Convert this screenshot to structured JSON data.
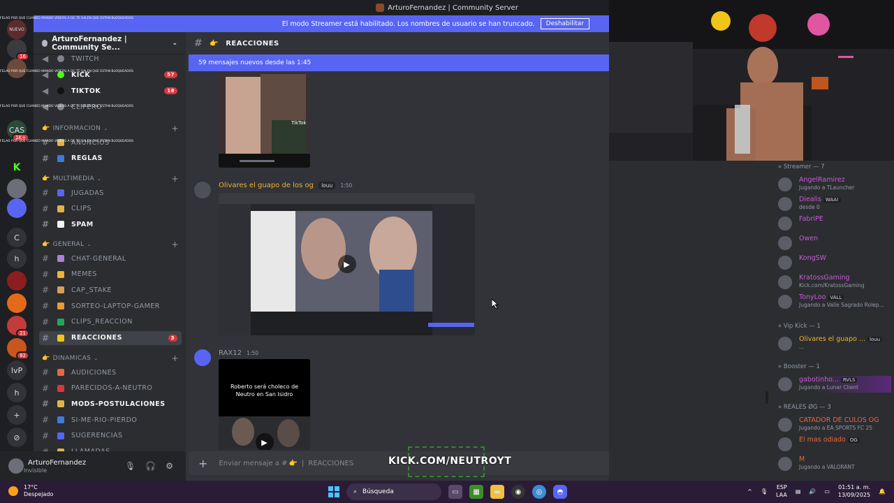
{
  "window": {
    "title": "ArturoFernandez | Community Server"
  },
  "banner": {
    "text": "El modo Streamer está habilitado. Los nombres de usuario se han truncado.",
    "button": "Deshabilitar"
  },
  "server": {
    "name": "ArturoFernandez | Community Se..."
  },
  "rail": [
    {
      "label": "NUEVO",
      "badge": ""
    },
    {
      "label": "",
      "badge": "16"
    },
    {
      "label": "",
      "badge": ""
    },
    {
      "label": "CAS",
      "badge": "1K+"
    },
    {
      "label": "K",
      "badge": ""
    },
    {
      "label": "",
      "badge": ""
    },
    {
      "label": "",
      "badge": ""
    },
    {
      "label": "C",
      "badge": ""
    },
    {
      "label": "h",
      "badge": ""
    },
    {
      "label": "",
      "badge": ""
    },
    {
      "label": "",
      "badge": ""
    },
    {
      "label": "",
      "badge": "21"
    },
    {
      "label": "",
      "badge": "82"
    },
    {
      "label": "lvP",
      "badge": ""
    },
    {
      "label": "h",
      "badge": ""
    },
    {
      "label": "+",
      "badge": ""
    },
    {
      "label": "⊘",
      "badge": ""
    }
  ],
  "sidebar": {
    "top_channels": [
      {
        "name": "TWITCH",
        "mention": "",
        "unread": false
      },
      {
        "name": "KICK",
        "mention": "57",
        "unread": true
      },
      {
        "name": "TIKTOK",
        "mention": "18",
        "unread": true
      },
      {
        "name": "CLIPERO",
        "mention": "",
        "unread": false
      }
    ],
    "categories": [
      {
        "name": "INFORMACION",
        "channels": [
          {
            "name": "ANUNCIOS",
            "mention": "",
            "unread": false
          },
          {
            "name": "REGLAS",
            "mention": "",
            "unread": true
          }
        ]
      },
      {
        "name": "MULTIMEDIA",
        "channels": [
          {
            "name": "JUGADAS",
            "mention": "",
            "unread": false
          },
          {
            "name": "CLIPS",
            "mention": "",
            "unread": false
          },
          {
            "name": "SPAM",
            "mention": "",
            "unread": true
          }
        ]
      },
      {
        "name": "GENERAL",
        "channels": [
          {
            "name": "CHAT-GENERAL",
            "mention": "",
            "unread": false
          },
          {
            "name": "MEMES",
            "mention": "",
            "unread": false
          },
          {
            "name": "CAP_STAKE",
            "mention": "",
            "unread": false
          },
          {
            "name": "SORTEO-LAPTOP-GAMER",
            "mention": "",
            "unread": false
          },
          {
            "name": "CLIPS_REACCION",
            "mention": "",
            "unread": false
          },
          {
            "name": "REACCIONES",
            "mention": "3",
            "unread": true,
            "active": true
          }
        ]
      },
      {
        "name": "DINAMICAS",
        "channels": [
          {
            "name": "AUDICIONES",
            "mention": "",
            "unread": false
          },
          {
            "name": "PARECIDOS-A-NEUTRO",
            "mention": "",
            "unread": false
          },
          {
            "name": "MODS-POSTULACIONES",
            "mention": "",
            "unread": true
          },
          {
            "name": "SI-ME-RIO-PIERDO",
            "mention": "",
            "unread": false
          },
          {
            "name": "SUGERENCIAS",
            "mention": "",
            "unread": false
          },
          {
            "name": "LLAMADAS",
            "mention": "",
            "unread": false
          }
        ]
      }
    ]
  },
  "user": {
    "name": "ArturoFernandez",
    "status": "Invisible"
  },
  "chat": {
    "channel": "REACCIONES",
    "new_messages": "59 mensajes nuevos desde las 1:45",
    "messages": [
      {
        "author": "Olivares el guapo de los og",
        "tag": "louu",
        "time": "1:50",
        "color": "#f0b232"
      },
      {
        "author": "RAX12",
        "tag": "",
        "time": "1:50",
        "color": "#949ba4"
      }
    ],
    "media_caption_1": "TikTok",
    "media_caption_3": "Roberto será choleco de Neutro en San Isidro",
    "composer_placeholder": "Enviar mensaje a #",
    "composer_channel": "REACCIONES"
  },
  "members": {
    "sections": [
      {
        "title": "Streamer — 7",
        "list": [
          {
            "name": "AngelRamirez",
            "activity": "Jugando a TLauncher",
            "color": "#c75bd6",
            "tag": ""
          },
          {
            "name": "Diealis",
            "activity": "desde 0",
            "color": "#c75bd6",
            "tag": "WAA!"
          },
          {
            "name": "FabriPE",
            "activity": "",
            "color": "#c75bd6",
            "tag": ""
          },
          {
            "name": "Owen",
            "activity": "",
            "color": "#c75bd6",
            "tag": ""
          },
          {
            "name": "KongSW",
            "activity": "",
            "color": "#c75bd6",
            "tag": ""
          },
          {
            "name": "KratossGaming",
            "activity": "Kick.com/KratossGaming",
            "color": "#c75bd6",
            "tag": ""
          },
          {
            "name": "TonyLoo",
            "activity": "Jugando a Valle Sagrado Rolep...",
            "color": "#c75bd6",
            "tag": "VALL"
          }
        ]
      },
      {
        "title": "Vip Kick — 1",
        "list": [
          {
            "name": "Olivares el guapo ...",
            "activity": "...",
            "color": "#f0b232",
            "tag": "louu"
          }
        ]
      },
      {
        "title": "Booster — 1",
        "list": [
          {
            "name": "gabotinho...",
            "activity": "Jugando a Lunar Client",
            "color": "#c75bd6",
            "tag": "RVLS"
          }
        ]
      },
      {
        "title": "REALES ØG — 3",
        "list": [
          {
            "name": "CATADOR DE CULOS OG",
            "activity": "Jugando a EA SPORTS FC 25",
            "color": "#e8673e",
            "tag": ""
          },
          {
            "name": "El mas odiado",
            "activity": "",
            "color": "#e8673e",
            "tag": "OG"
          },
          {
            "name": "M",
            "activity": "Jugando a VALORANT",
            "color": "#e8673e",
            "tag": ""
          }
        ]
      }
    ]
  },
  "overlay": {
    "chat_line": "FELAO POR QUE CUANDO MANDO VIDEOS A DC TE SALEN QUE ESTAN BLOQUEADOS",
    "kick_url": "KICK.COM/NEUTROYT"
  },
  "taskbar": {
    "temp": "17°C",
    "weather": "Despejado",
    "search": "Búsqueda",
    "lang": "ESP",
    "lang_sub": "LAA",
    "time": "01:51 a. m.",
    "date": "13/09/2025"
  }
}
